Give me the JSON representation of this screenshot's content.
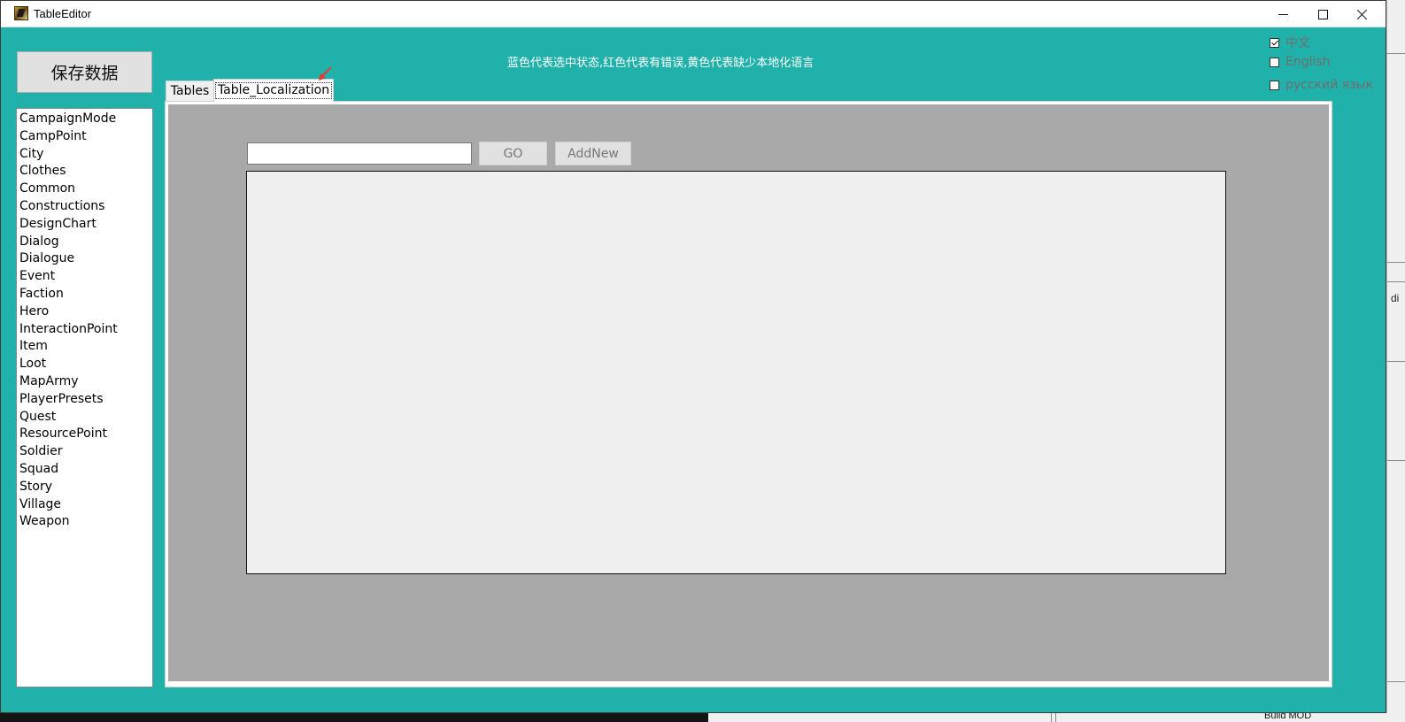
{
  "window": {
    "title": "TableEditor"
  },
  "toolbar": {
    "save_label": "保存数据"
  },
  "legend": {
    "text": "蓝色代表选中状态,红色代表有错误,黄色代表缺少本地化语言"
  },
  "languages": [
    {
      "label": "中文",
      "checked": true
    },
    {
      "label": "English",
      "checked": false
    },
    {
      "label": "русский язык",
      "checked": false
    }
  ],
  "tables": [
    "CampaignMode",
    "CampPoint",
    "City",
    "Clothes",
    "Common",
    "Constructions",
    "DesignChart",
    "Dialog",
    "Dialogue",
    "Event",
    "Faction",
    "Hero",
    "InteractionPoint",
    "Item",
    "Loot",
    "MapArmy",
    "PlayerPresets",
    "Quest",
    "ResourcePoint",
    "Soldier",
    "Squad",
    "Story",
    "Village",
    "Weapon"
  ],
  "tabs": {
    "tables": "Tables",
    "localization": "Table_Localization"
  },
  "localization": {
    "search_value": "",
    "go_label": "GO",
    "addnew_label": "AddNew"
  },
  "background": {
    "right_tab_text": "di",
    "bottom_text": "Build MOD"
  },
  "colors": {
    "window_bg": "#20b2aa",
    "panel_bg": "#a9a9a9",
    "grid_bg": "#f0f0f0",
    "arrow": "#e53935"
  }
}
